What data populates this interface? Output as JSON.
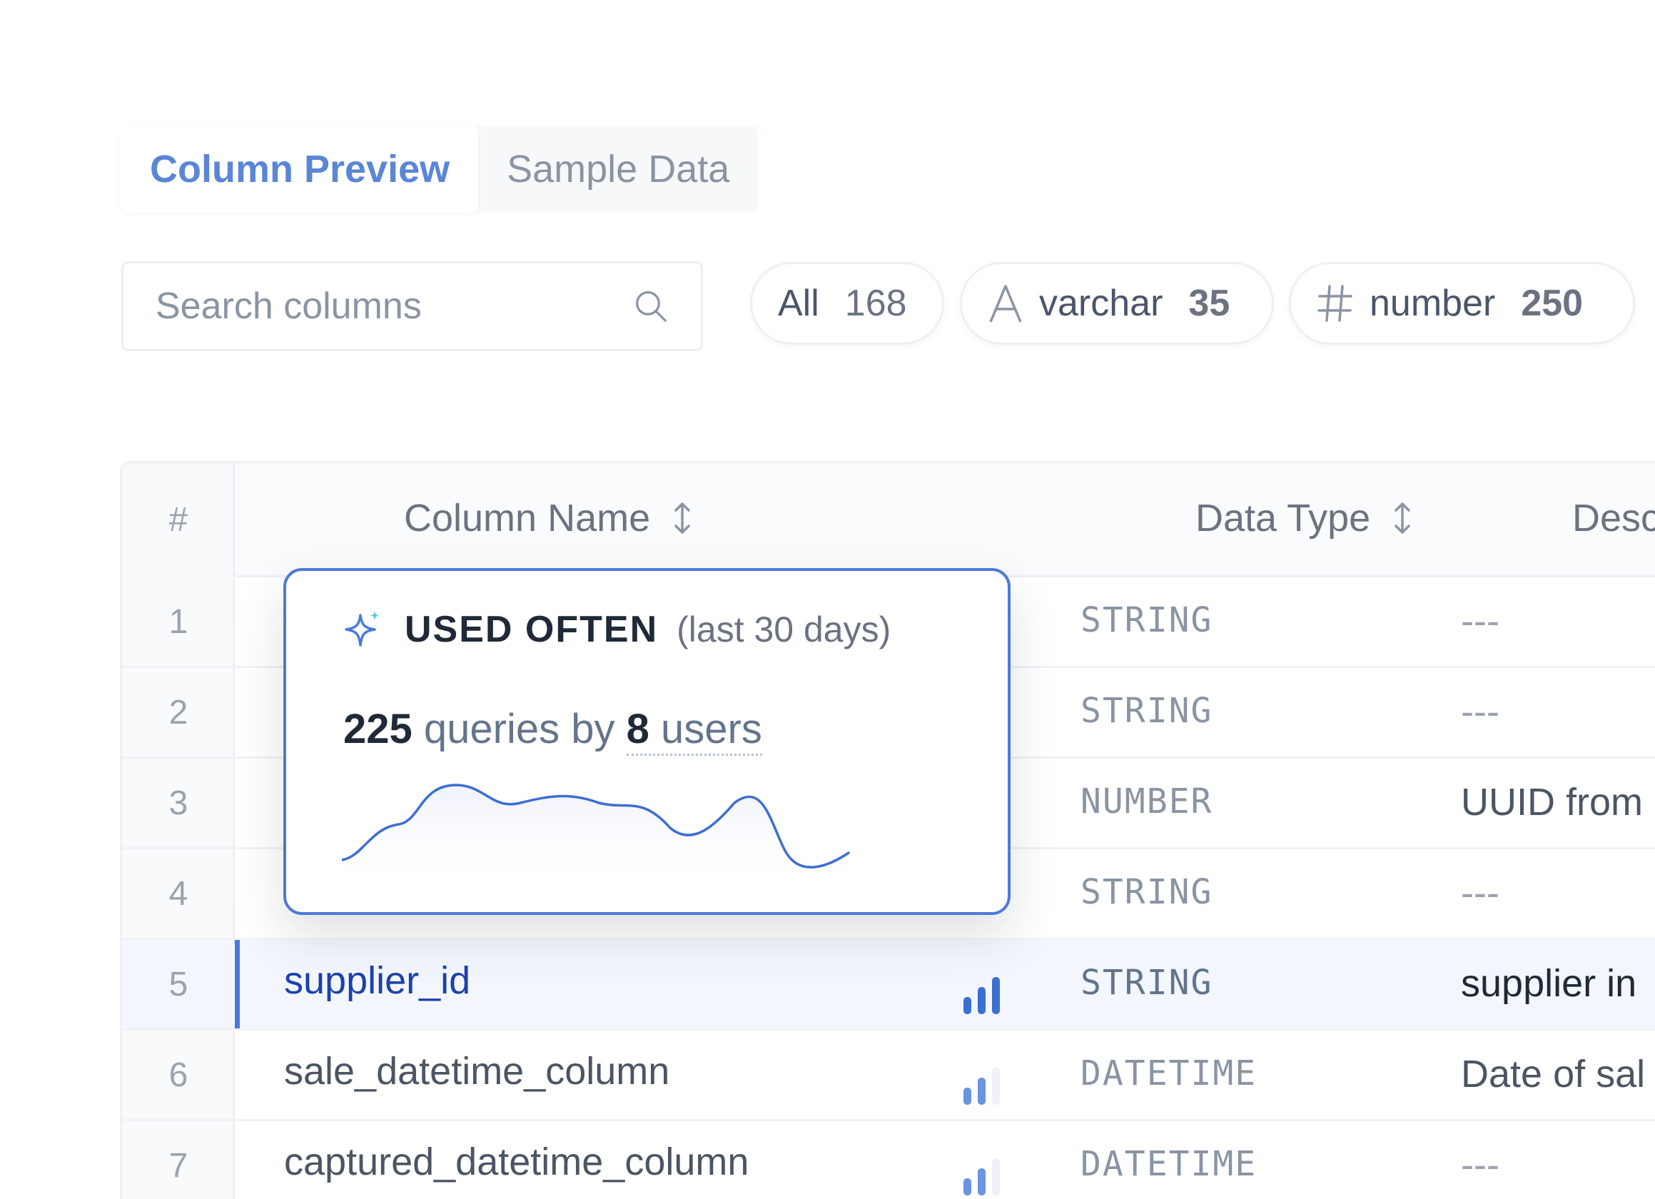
{
  "tabs": [
    {
      "label": "Column Preview",
      "active": true
    },
    {
      "label": "Sample Data",
      "active": false
    }
  ],
  "search": {
    "placeholder": "Search columns",
    "value": ""
  },
  "filters": [
    {
      "label": "All",
      "count": "168",
      "icon": ""
    },
    {
      "label": "varchar",
      "count": "35",
      "icon": "text-type-icon"
    },
    {
      "label": "number",
      "count": "250",
      "icon": "hash-icon"
    }
  ],
  "table": {
    "headers": {
      "num": "#",
      "name": "Column Name",
      "type": "Data Type",
      "desc": "Description"
    },
    "rows": [
      {
        "num": "1",
        "name": "",
        "type": "STRING",
        "desc": "---"
      },
      {
        "num": "2",
        "name": "",
        "type": "STRING",
        "desc": "---"
      },
      {
        "num": "3",
        "name": "",
        "type": "NUMBER",
        "desc": "UUID from"
      },
      {
        "num": "4",
        "name": "",
        "type": "STRING",
        "desc": "---"
      },
      {
        "num": "5",
        "name": "supplier_id",
        "type": "STRING",
        "desc": "supplier in",
        "usage": 3,
        "selected": true
      },
      {
        "num": "6",
        "name": "sale_datetime_column",
        "type": "DATETIME",
        "desc": "Date of sal",
        "usage": 2
      },
      {
        "num": "7",
        "name": "captured_datetime_column",
        "type": "DATETIME",
        "desc": "---",
        "usage": 2
      }
    ]
  },
  "popover": {
    "title": "USED OFTEN",
    "period": "(last 30 days)",
    "queries": "225",
    "queries_label": "queries by",
    "users": "8",
    "users_label": "users"
  },
  "colors": {
    "accent": "#4c7ad8",
    "usage_bar": "#3b6fd4",
    "usage_bar_dim": "#e5e9f0"
  }
}
